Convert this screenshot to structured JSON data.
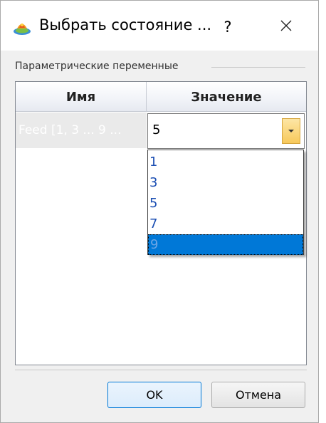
{
  "window": {
    "title": "Выбрать состояние ...",
    "help_label": "?",
    "icon": "app-icon",
    "close_icon": "close-icon"
  },
  "group": {
    "label": "Параметрические переменные"
  },
  "grid": {
    "columns": [
      "Имя",
      "Значение"
    ],
    "rows": [
      {
        "name": "Feed [1, 3 ... 9 ...",
        "value": "5"
      }
    ]
  },
  "dropdown": {
    "options": [
      "1",
      "3",
      "5",
      "7",
      "9"
    ],
    "highlighted": "9"
  },
  "buttons": {
    "ok": "OK",
    "cancel": "Отмена"
  },
  "colors": {
    "selection": "#0078d7",
    "option_text": "#1c4fb3",
    "combo_button": "#f7c95b"
  }
}
